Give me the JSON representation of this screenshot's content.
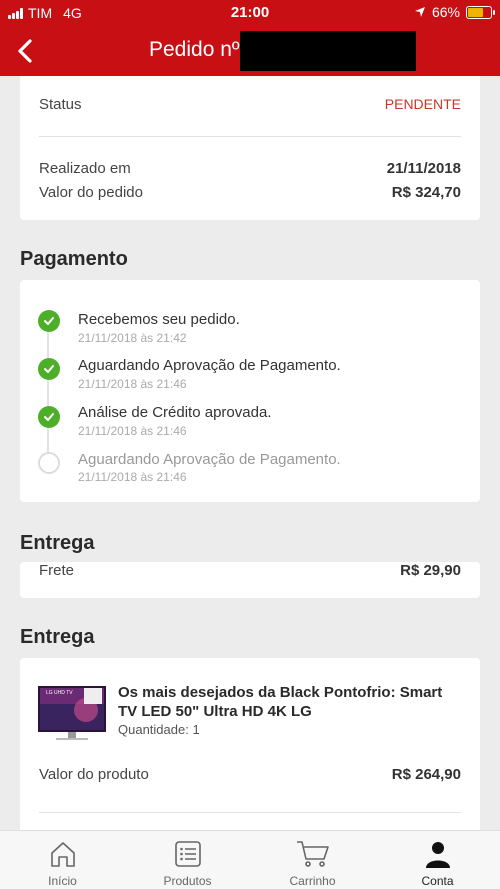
{
  "status_bar": {
    "carrier": "TIM",
    "network": "4G",
    "time": "21:00",
    "battery": "66%",
    "battery_level": 0.66
  },
  "header": {
    "title": "Pedido nº 1"
  },
  "summary": {
    "status_label": "Status",
    "status_value": "PENDENTE",
    "date_label": "Realizado em",
    "date_value": "21/11/2018",
    "total_label": "Valor do pedido",
    "total_value": "R$  324,70"
  },
  "payment": {
    "heading": "Pagamento",
    "steps": [
      {
        "title": "Recebemos seu pedido.",
        "date": "21/11/2018 às 21:42",
        "done": true
      },
      {
        "title": "Aguardando Aprovação de Pagamento.",
        "date": "21/11/2018 às 21:46",
        "done": true
      },
      {
        "title": "Análise de Crédito aprovada.",
        "date": "21/11/2018 às 21:46",
        "done": true
      },
      {
        "title": "Aguardando Aprovação de Pagamento.",
        "date": "21/11/2018 às 21:46",
        "done": false
      }
    ]
  },
  "shipping": {
    "heading": "Entrega",
    "freight_label": "Frete",
    "freight_value": "R$  29,90"
  },
  "delivery": {
    "heading": "Entrega",
    "product_name": "Os mais desejados da Black Pontofrio: Smart TV LED 50\" Ultra HD 4K LG",
    "quantity": "Quantidade: 1",
    "price_label": "Valor do produto",
    "price_value": "R$  264,90",
    "image_brand_text": "LG UHD TV"
  },
  "tabs": [
    {
      "label": "Início",
      "icon": "home-icon"
    },
    {
      "label": "Produtos",
      "icon": "list-icon"
    },
    {
      "label": "Carrinho",
      "icon": "cart-icon"
    },
    {
      "label": "Conta",
      "icon": "user-icon",
      "active": true
    }
  ],
  "colors": {
    "brand_red": "#c80f14",
    "status_pending": "#c0392b",
    "step_done": "#4caf2a"
  }
}
